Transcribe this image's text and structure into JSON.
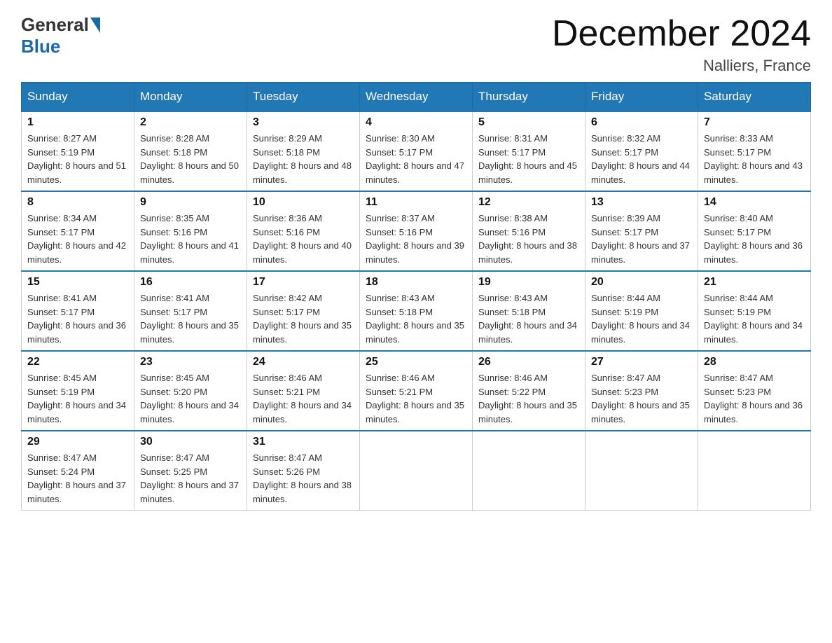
{
  "header": {
    "logo_general": "General",
    "logo_blue": "Blue",
    "month_title": "December 2024",
    "location": "Nalliers, France"
  },
  "days_of_week": [
    "Sunday",
    "Monday",
    "Tuesday",
    "Wednesday",
    "Thursday",
    "Friday",
    "Saturday"
  ],
  "weeks": [
    [
      {
        "day": "1",
        "sunrise": "8:27 AM",
        "sunset": "5:19 PM",
        "daylight": "8 hours and 51 minutes."
      },
      {
        "day": "2",
        "sunrise": "8:28 AM",
        "sunset": "5:18 PM",
        "daylight": "8 hours and 50 minutes."
      },
      {
        "day": "3",
        "sunrise": "8:29 AM",
        "sunset": "5:18 PM",
        "daylight": "8 hours and 48 minutes."
      },
      {
        "day": "4",
        "sunrise": "8:30 AM",
        "sunset": "5:17 PM",
        "daylight": "8 hours and 47 minutes."
      },
      {
        "day": "5",
        "sunrise": "8:31 AM",
        "sunset": "5:17 PM",
        "daylight": "8 hours and 45 minutes."
      },
      {
        "day": "6",
        "sunrise": "8:32 AM",
        "sunset": "5:17 PM",
        "daylight": "8 hours and 44 minutes."
      },
      {
        "day": "7",
        "sunrise": "8:33 AM",
        "sunset": "5:17 PM",
        "daylight": "8 hours and 43 minutes."
      }
    ],
    [
      {
        "day": "8",
        "sunrise": "8:34 AM",
        "sunset": "5:17 PM",
        "daylight": "8 hours and 42 minutes."
      },
      {
        "day": "9",
        "sunrise": "8:35 AM",
        "sunset": "5:16 PM",
        "daylight": "8 hours and 41 minutes."
      },
      {
        "day": "10",
        "sunrise": "8:36 AM",
        "sunset": "5:16 PM",
        "daylight": "8 hours and 40 minutes."
      },
      {
        "day": "11",
        "sunrise": "8:37 AM",
        "sunset": "5:16 PM",
        "daylight": "8 hours and 39 minutes."
      },
      {
        "day": "12",
        "sunrise": "8:38 AM",
        "sunset": "5:16 PM",
        "daylight": "8 hours and 38 minutes."
      },
      {
        "day": "13",
        "sunrise": "8:39 AM",
        "sunset": "5:17 PM",
        "daylight": "8 hours and 37 minutes."
      },
      {
        "day": "14",
        "sunrise": "8:40 AM",
        "sunset": "5:17 PM",
        "daylight": "8 hours and 36 minutes."
      }
    ],
    [
      {
        "day": "15",
        "sunrise": "8:41 AM",
        "sunset": "5:17 PM",
        "daylight": "8 hours and 36 minutes."
      },
      {
        "day": "16",
        "sunrise": "8:41 AM",
        "sunset": "5:17 PM",
        "daylight": "8 hours and 35 minutes."
      },
      {
        "day": "17",
        "sunrise": "8:42 AM",
        "sunset": "5:17 PM",
        "daylight": "8 hours and 35 minutes."
      },
      {
        "day": "18",
        "sunrise": "8:43 AM",
        "sunset": "5:18 PM",
        "daylight": "8 hours and 35 minutes."
      },
      {
        "day": "19",
        "sunrise": "8:43 AM",
        "sunset": "5:18 PM",
        "daylight": "8 hours and 34 minutes."
      },
      {
        "day": "20",
        "sunrise": "8:44 AM",
        "sunset": "5:19 PM",
        "daylight": "8 hours and 34 minutes."
      },
      {
        "day": "21",
        "sunrise": "8:44 AM",
        "sunset": "5:19 PM",
        "daylight": "8 hours and 34 minutes."
      }
    ],
    [
      {
        "day": "22",
        "sunrise": "8:45 AM",
        "sunset": "5:19 PM",
        "daylight": "8 hours and 34 minutes."
      },
      {
        "day": "23",
        "sunrise": "8:45 AM",
        "sunset": "5:20 PM",
        "daylight": "8 hours and 34 minutes."
      },
      {
        "day": "24",
        "sunrise": "8:46 AM",
        "sunset": "5:21 PM",
        "daylight": "8 hours and 34 minutes."
      },
      {
        "day": "25",
        "sunrise": "8:46 AM",
        "sunset": "5:21 PM",
        "daylight": "8 hours and 35 minutes."
      },
      {
        "day": "26",
        "sunrise": "8:46 AM",
        "sunset": "5:22 PM",
        "daylight": "8 hours and 35 minutes."
      },
      {
        "day": "27",
        "sunrise": "8:47 AM",
        "sunset": "5:23 PM",
        "daylight": "8 hours and 35 minutes."
      },
      {
        "day": "28",
        "sunrise": "8:47 AM",
        "sunset": "5:23 PM",
        "daylight": "8 hours and 36 minutes."
      }
    ],
    [
      {
        "day": "29",
        "sunrise": "8:47 AM",
        "sunset": "5:24 PM",
        "daylight": "8 hours and 37 minutes."
      },
      {
        "day": "30",
        "sunrise": "8:47 AM",
        "sunset": "5:25 PM",
        "daylight": "8 hours and 37 minutes."
      },
      {
        "day": "31",
        "sunrise": "8:47 AM",
        "sunset": "5:26 PM",
        "daylight": "8 hours and 38 minutes."
      },
      null,
      null,
      null,
      null
    ]
  ]
}
